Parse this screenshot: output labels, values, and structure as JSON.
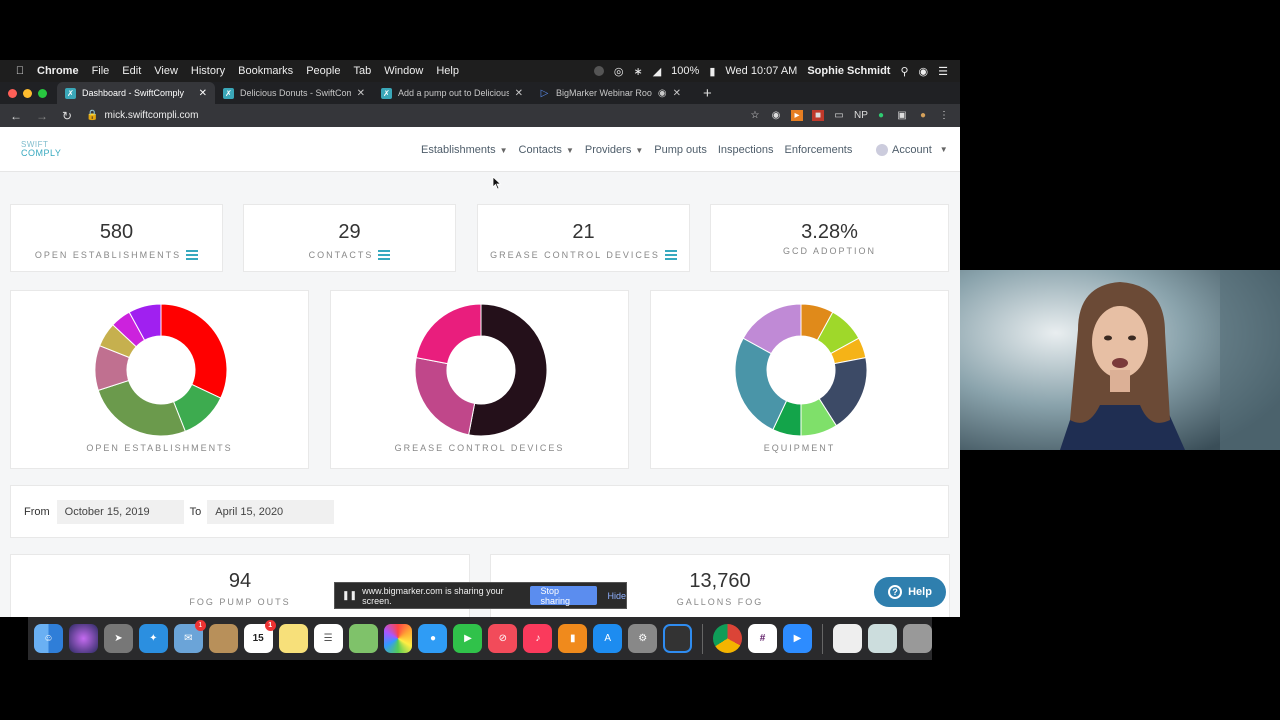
{
  "menubar": {
    "app": "Chrome",
    "items": [
      "File",
      "Edit",
      "View",
      "History",
      "Bookmarks",
      "People",
      "Tab",
      "Window",
      "Help"
    ],
    "battery": "100%",
    "clock": "Wed 10:07 AM",
    "user": "Sophie Schmidt"
  },
  "tabs": [
    {
      "title": "Dashboard - SwiftComply",
      "icon": "swiftcomply-favicon",
      "active": true
    },
    {
      "title": "Delicious Donuts - SwiftComply",
      "icon": "swiftcomply-favicon"
    },
    {
      "title": "Add a pump out to Delicious Donuts",
      "icon": "swiftcomply-favicon"
    },
    {
      "title": "BigMarker Webinar Room",
      "icon": "bigmarker-favicon"
    }
  ],
  "address": {
    "url": "mick.swiftcompli.com"
  },
  "app": {
    "logo_top": "SWIFT",
    "logo_bottom": "COMPLY",
    "nav": {
      "establishments": "Establishments",
      "contacts": "Contacts",
      "providers": "Providers",
      "pumpouts": "Pump outs",
      "inspections": "Inspections",
      "enforcements": "Enforcements",
      "account": "Account"
    },
    "stats": [
      {
        "value": "580",
        "label": "OPEN ESTABLISHMENTS"
      },
      {
        "value": "29",
        "label": "CONTACTS"
      },
      {
        "value": "21",
        "label": "GREASE CONTROL DEVICES"
      },
      {
        "value": "3.28%",
        "label": "GCD ADOPTION"
      }
    ],
    "donuts": [
      {
        "label": "OPEN ESTABLISHMENTS",
        "slices": [
          {
            "value": 32,
            "color": "#ff0000"
          },
          {
            "value": 12,
            "color": "#3dab4f"
          },
          {
            "value": 26,
            "color": "#6b9a4c"
          },
          {
            "value": 11,
            "color": "#c07090"
          },
          {
            "value": 6,
            "color": "#c6b04e"
          },
          {
            "value": 5,
            "color": "#cc22dd"
          },
          {
            "value": 8,
            "color": "#a020f0"
          }
        ]
      },
      {
        "label": "GREASE CONTROL DEVICES",
        "slices": [
          {
            "value": 53,
            "color": "#24101a"
          },
          {
            "value": 25,
            "color": "#c0478a"
          },
          {
            "value": 22,
            "color": "#e91e7d"
          }
        ]
      },
      {
        "label": "EQUIPMENT",
        "slices": [
          {
            "value": 8,
            "color": "#e08a1a"
          },
          {
            "value": 9,
            "color": "#9fd82a"
          },
          {
            "value": 5,
            "color": "#f5b317"
          },
          {
            "value": 19,
            "color": "#3c4a66"
          },
          {
            "value": 9,
            "color": "#7fe06a"
          },
          {
            "value": 7,
            "color": "#13a44a"
          },
          {
            "value": 26,
            "color": "#4a95a8"
          },
          {
            "value": 17,
            "color": "#c08ad6"
          }
        ]
      }
    ],
    "date_filter": {
      "from_label": "From",
      "from_value": "October 15, 2019",
      "to_label": "To",
      "to_value": "April 15, 2020"
    },
    "bottom_stats": [
      {
        "value": "94",
        "label": "FOG PUMP OUTS"
      },
      {
        "value": "13,760",
        "label": "GALLONS FOG"
      }
    ],
    "help_label": "Help"
  },
  "share_bar": {
    "text": "www.bigmarker.com is sharing your screen.",
    "stop_label": "Stop sharing",
    "hide_label": "Hide"
  },
  "dock": {
    "items": [
      "finder",
      "siri",
      "launchpad",
      "safari",
      "mail",
      "contacts",
      "calendar",
      "notes",
      "reminders",
      "maps",
      "photos",
      "messages",
      "facetime",
      "news",
      "music",
      "books",
      "app-store",
      "system-preferences",
      "mission-control",
      "chrome",
      "slack",
      "zoom",
      "preview",
      "screenshot",
      "trash"
    ],
    "calendar_day": "15"
  },
  "colors": {
    "accent": "#37a9bf",
    "help": "#2f7fae",
    "share_button": "#5b8def"
  }
}
